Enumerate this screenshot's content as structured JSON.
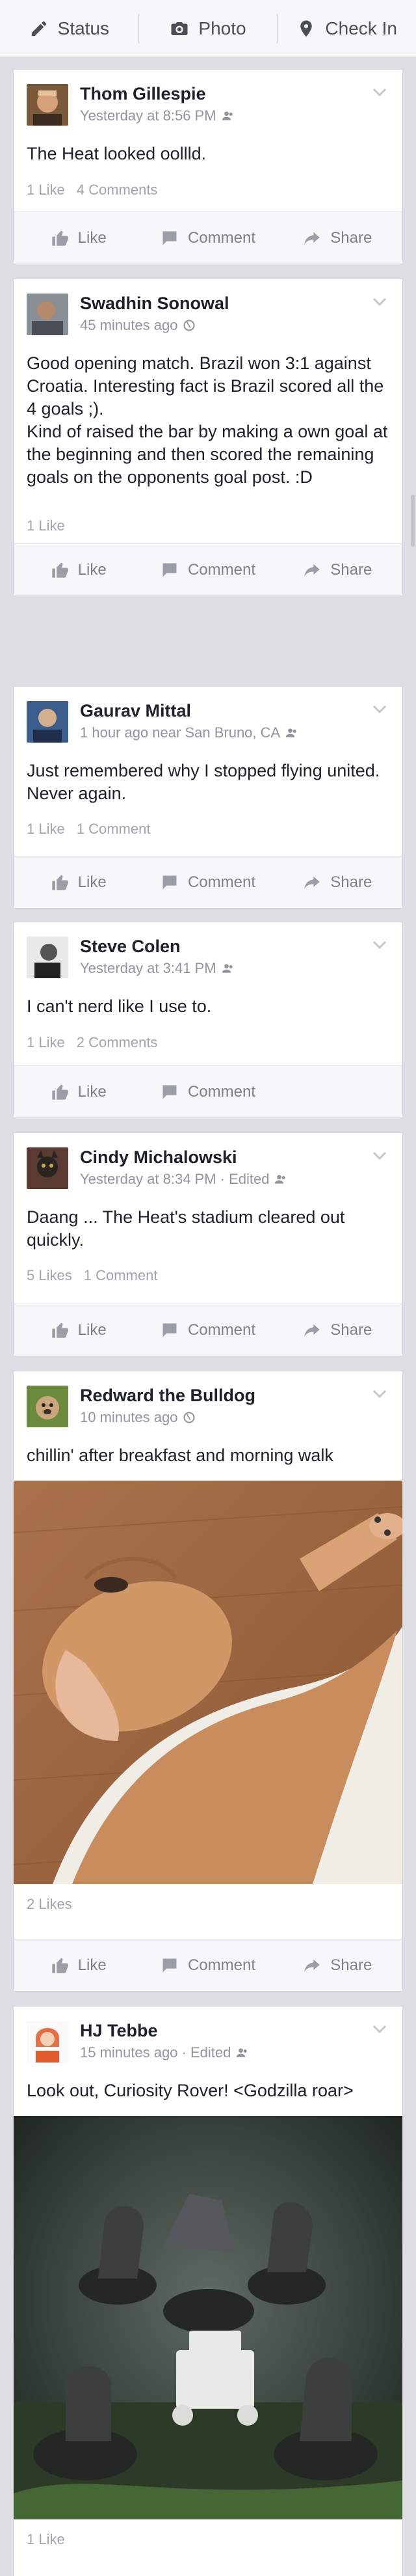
{
  "topbar": {
    "status": "Status",
    "photo": "Photo",
    "checkin": "Check In"
  },
  "actions": {
    "like": "Like",
    "comment": "Comment",
    "share": "Share"
  },
  "posts": [
    {
      "name": "Thom Gillespie",
      "meta": "Yesterday at 8:56 PM",
      "text": "The Heat looked oollld.",
      "likes": "1 Like",
      "comments": "4 Comments"
    },
    {
      "name": "Swadhin Sonowal",
      "meta": "45 minutes ago",
      "text": "Good opening match. Brazil won 3:1 against Croatia. Interesting fact is Brazil scored all the 4 goals ;).\nKind of raised the bar by making a own goal at the beginning and then scored the remaining goals on the opponents goal post. :D",
      "likes": "1 Like",
      "comments": ""
    },
    {
      "name": "Gaurav Mittal",
      "meta": "1 hour ago near San Bruno, CA",
      "text": "Just remembered why I stopped flying united. Never again.",
      "likes": "1 Like",
      "comments": "1 Comment"
    },
    {
      "name": "Steve Colen",
      "meta": "Yesterday at 3:41 PM",
      "text": "I can't nerd like I use to.",
      "likes": "1 Like",
      "comments": "2 Comments"
    },
    {
      "name": "Cindy Michalowski",
      "meta": "Yesterday at 8:34 PM · Edited",
      "text": "Daang ... The Heat's stadium cleared out quickly.",
      "likes": "5 Likes",
      "comments": "1 Comment"
    },
    {
      "name": "Redward the Bulldog",
      "meta": "10 minutes ago",
      "text": "chillin' after breakfast and morning walk",
      "likes": "2 Likes",
      "comments": ""
    },
    {
      "name": "HJ Tebbe",
      "meta": "15 minutes ago · Edited",
      "text": "Look out, Curiosity Rover! <Godzilla roar>",
      "likes": "1 Like",
      "comments": ""
    }
  ]
}
